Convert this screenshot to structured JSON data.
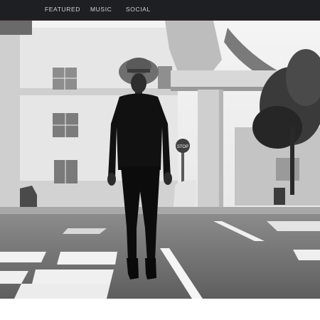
{
  "nav": {
    "items": [
      {
        "label": "FEATURED"
      },
      {
        "label": "MUSIC"
      },
      {
        "label": "SOCIAL"
      }
    ]
  },
  "hero": {
    "image": "black-and-white street photo of a woman in a wide-brim hat and black outfit standing on a crosswalk",
    "signs": {
      "stop": "STOP"
    }
  },
  "colors": {
    "navbar_bg": "#1d1f23",
    "nav_text": "#d4d5d7",
    "accent_line": "#3a2428"
  }
}
